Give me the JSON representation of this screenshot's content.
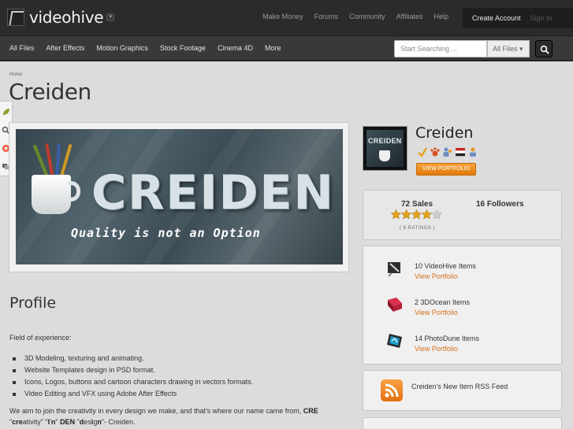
{
  "brand": {
    "name": "videohive"
  },
  "top_links": [
    "Make Money",
    "Forums",
    "Community",
    "Affiliates",
    "Help"
  ],
  "auth": {
    "create": "Create Account",
    "signin": "Sign In"
  },
  "nav_links": [
    "All Files",
    "After Effects",
    "Motion Graphics",
    "Stock Footage",
    "Cinema 4D",
    "More"
  ],
  "search": {
    "placeholder": "Start Searching ...",
    "scope": "All Files"
  },
  "breadcrumb": "Home",
  "page_title": "Creiden",
  "banner": {
    "word": "CREIDEN",
    "tagline": "Quality is not an Option"
  },
  "profile": {
    "heading": "Profile",
    "field_label": "Field of  experience:",
    "skills": [
      "3D Modeling, texturing and animating.",
      "Website Templates design in PSD format.",
      "Icons, Logos, buttons and cartoon characters drawing in vectors formats.",
      "Video Editing and VFX  using Adobe After Effects"
    ],
    "about_pre": "We aim to join the creativity in every design we make, and that's where our name came from, ",
    "about_cre": "CRE",
    "about_l2": [
      {
        "t": "\"",
        "b": false
      },
      {
        "t": "cre",
        "b": true
      },
      {
        "t": "ativity\" \"",
        "b": false
      },
      {
        "t": "I",
        "b": true
      },
      {
        "t": "'",
        "b": false
      },
      {
        "t": "n",
        "b": true
      },
      {
        "t": "\" ",
        "b": false
      },
      {
        "t": "DEN",
        "b": true
      },
      {
        "t": " \"",
        "b": false
      },
      {
        "t": "d",
        "b": true
      },
      {
        "t": "es",
        "b": false
      },
      {
        "t": "i",
        "b": true
      },
      {
        "t": "g",
        "b": false
      },
      {
        "t": "n",
        "b": true
      },
      {
        "t": "\"- Creiden.",
        "b": false
      }
    ]
  },
  "author": {
    "avatar_word": "CREIDEN",
    "name": "Creiden",
    "view_portfolio": "VIEW PORTFOLIO",
    "stats": {
      "sales": "72 Sales",
      "followers": "16 Followers",
      "rating_stars": 4,
      "rating_max": 5,
      "rating_count": "( 6 RATINGS )"
    },
    "items": [
      {
        "count": "10 VideoHive Items",
        "link": "View Portfolio",
        "color": "#2d2d2d"
      },
      {
        "count": "2 3DOcean Items",
        "link": "View Portfolio",
        "color": "#b8213a"
      },
      {
        "count": "14 PhotoDune Items",
        "link": "View Portfolio",
        "color": "#1e7fa3"
      }
    ],
    "rss": "Creiden's New Item RSS Feed"
  },
  "colors": {
    "accent": "#e07a0d",
    "link": "#d4701a",
    "topbar": "#2b2b2b",
    "navbar": "#393939"
  }
}
